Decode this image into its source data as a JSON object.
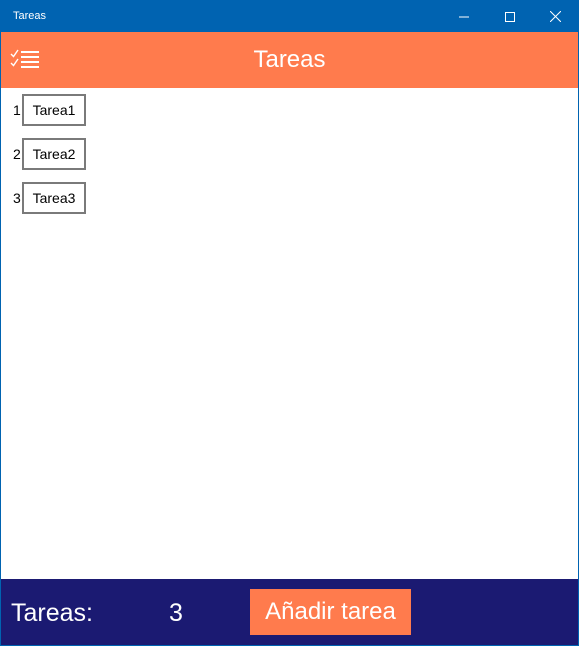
{
  "window": {
    "title": "Tareas"
  },
  "header": {
    "title": "Tareas",
    "menu_icon": "checklist-icon"
  },
  "tasks": [
    {
      "number": "1",
      "name": "Tarea1"
    },
    {
      "number": "2",
      "name": "Tarea2"
    },
    {
      "number": "3",
      "name": "Tarea3"
    }
  ],
  "footer": {
    "count_label": "Tareas:",
    "count_value": "3",
    "add_button_label": "Añadir tarea"
  },
  "colors": {
    "titlebar": "#0063b1",
    "accent": "#ff7b4d",
    "footer": "#1b1a72"
  }
}
